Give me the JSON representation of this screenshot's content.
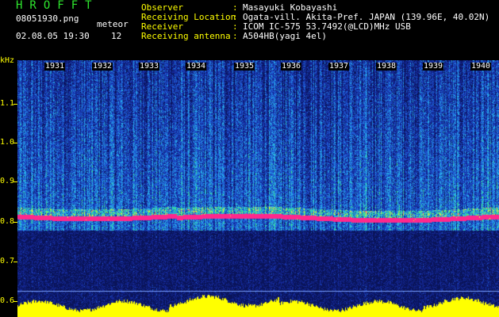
{
  "header": {
    "brand": "HROFFT",
    "filename": "08051930.png",
    "datetime": "02.08.05 19:30",
    "mode_label": "meteor",
    "meteor_count": "12",
    "fields": [
      {
        "key": "Observer",
        "value": "Masayuki Kobayashi"
      },
      {
        "key": "Receiving Location",
        "value": "Ogata-vill. Akita-Pref. JAPAN (139.96E, 40.02N)"
      },
      {
        "key": "Receiver",
        "value": "ICOM IC-575 53.7492(@LCD)MHz USB"
      },
      {
        "key": "Receiving antenna",
        "value": "A504HB(yagi 4el)"
      }
    ]
  },
  "axis": {
    "unit": "kHz",
    "y_ticks": [
      "1.1",
      "1.0",
      "0.9",
      "0.8",
      "0.7",
      "0.6"
    ],
    "time_labels": [
      "1931",
      "1932",
      "1933",
      "1934",
      "1935",
      "1936",
      "1937",
      "1938",
      "1939",
      "1940"
    ]
  },
  "colors": {
    "background": "#000000",
    "label_yellow": "#ffff00",
    "brand_green": "#2ee62e",
    "signal_magenta": "#ff2a8a"
  }
}
